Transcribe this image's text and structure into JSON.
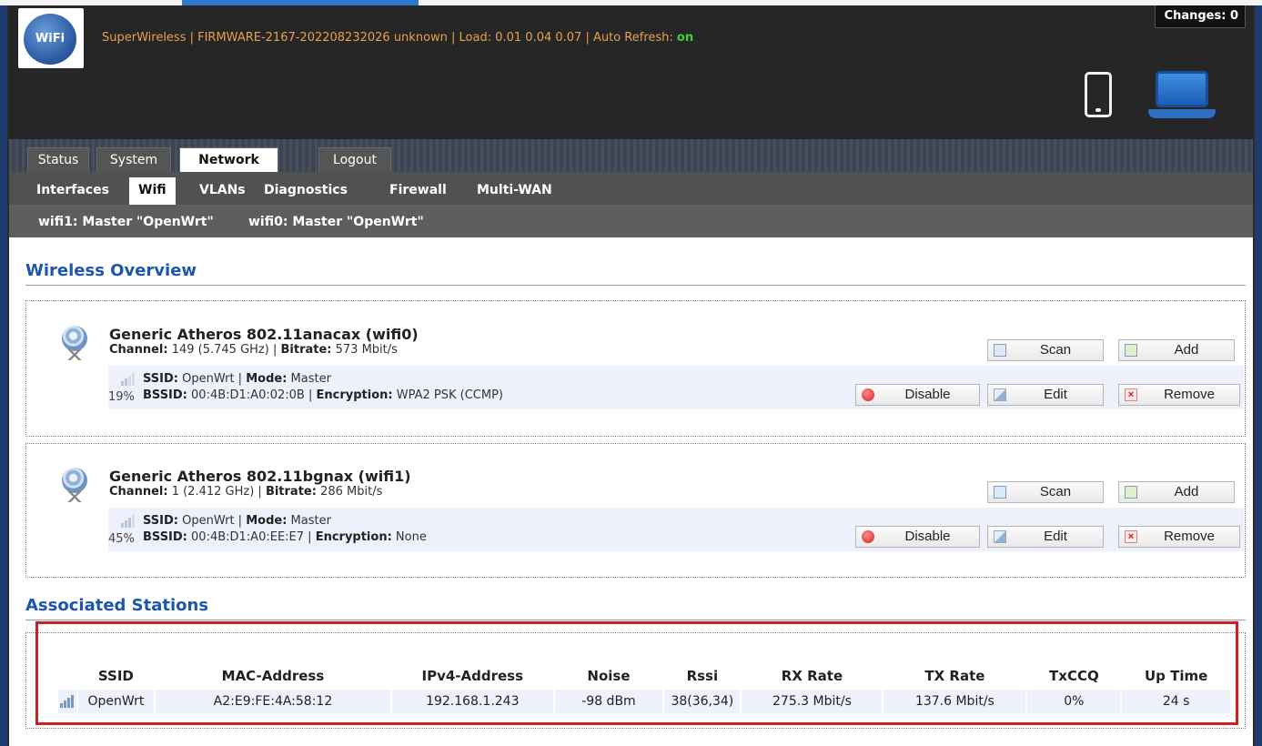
{
  "header": {
    "logo_text": "WiFi",
    "info_prefix": "SuperWireless | FIRMWARE-2167-202208232026 unknown | Load: 0.01 0.04 0.07 | Auto Refresh: ",
    "auto_refresh_state": "on",
    "changes": "Changes: 0"
  },
  "nav": {
    "main_tabs": [
      "Status",
      "System",
      "Network",
      "Logout"
    ],
    "sub_tabs": [
      "Interfaces",
      "Wifi",
      "VLANs",
      "Diagnostics",
      "Firewall",
      "Multi-WAN"
    ],
    "wifi_tabs": [
      "wifi1: Master \"OpenWrt\"",
      "wifi0: Master \"OpenWrt\""
    ]
  },
  "wireless_overview": {
    "title": "Wireless Overview",
    "devices": [
      {
        "name": "Generic Atheros 802.11anacax (wifi0)",
        "channel_label": "Channel:",
        "channel": "149 (5.745 GHz)",
        "bitrate_label": "Bitrate:",
        "bitrate": "573 Mbit/s",
        "signal_pct": "19%",
        "ssid_label": "SSID:",
        "ssid": "OpenWrt",
        "mode_label": "Mode:",
        "mode": "Master",
        "bssid_label": "BSSID:",
        "bssid": "00:4B:D1:A0:02:0B",
        "encryption_label": "Encryption:",
        "encryption": "WPA2 PSK (CCMP)"
      },
      {
        "name": "Generic Atheros 802.11bgnax (wifi1)",
        "channel_label": "Channel:",
        "channel": "1 (2.412 GHz)",
        "bitrate_label": "Bitrate:",
        "bitrate": "286 Mbit/s",
        "signal_pct": "45%",
        "ssid_label": "SSID:",
        "ssid": "OpenWrt",
        "mode_label": "Mode:",
        "mode": "Master",
        "bssid_label": "BSSID:",
        "bssid": "00:4B:D1:A0:EE:E7",
        "encryption_label": "Encryption:",
        "encryption": "None"
      }
    ],
    "buttons": {
      "scan": "Scan",
      "add": "Add",
      "disable": "Disable",
      "edit": "Edit",
      "remove": "Remove"
    }
  },
  "associated_stations": {
    "title": "Associated Stations",
    "columns": [
      "SSID",
      "MAC-Address",
      "IPv4-Address",
      "Noise",
      "Rssi",
      "RX Rate",
      "TX Rate",
      "TxCCQ",
      "Up Time"
    ],
    "rows": [
      [
        "OpenWrt",
        "A2:E9:FE:4A:58:12",
        "192.168.1.243",
        "-98 dBm",
        "38(36,34)",
        "275.3 Mbit/s",
        "137.6 Mbit/s",
        "0%",
        "24 s"
      ]
    ]
  }
}
